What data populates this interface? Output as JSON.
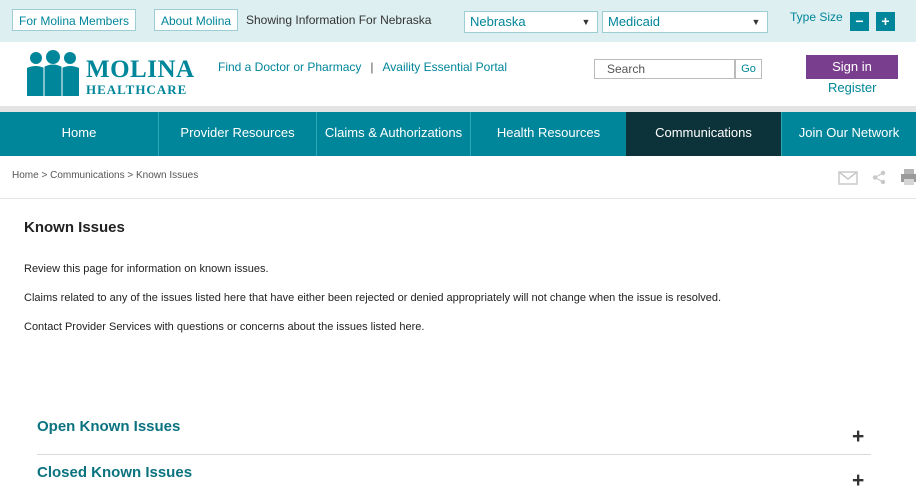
{
  "topbar": {
    "members_tab": "For Molina Members",
    "about_tab": "About Molina",
    "showing_text": "Showing Information For Nebraska",
    "state_select": "Nebraska",
    "plan_select": "Medicaid",
    "type_size_label": "Type Size",
    "decrease": "−",
    "increase": "+"
  },
  "header": {
    "logo_word": "MOLINA",
    "logo_sub": "HEALTHCARE",
    "link_find": "Find a Doctor or Pharmacy",
    "link_sep": "|",
    "link_availity": "Availity Essential Portal",
    "search_placeholder": "Search",
    "go": "Go",
    "sign_in": "Sign in",
    "register": "Register"
  },
  "nav": {
    "items": [
      {
        "label": "Home"
      },
      {
        "label": "Provider Resources"
      },
      {
        "label": "Claims & Authorizations"
      },
      {
        "label": "Health Resources"
      },
      {
        "label": "Communications"
      },
      {
        "label": "Join Our Network"
      }
    ]
  },
  "breadcrumb": {
    "home": "Home",
    "sep": " > ",
    "communications": "Communications",
    "current": "Known Issues"
  },
  "content": {
    "title": "Known Issues",
    "p1": "Review this page for information on known issues.",
    "p2": "Claims related to any of the issues listed here that have either been rejected or denied appropriately will not change when the issue is resolved.",
    "p3": "Contact Provider Services with questions or concerns about the issues listed here."
  },
  "accordion": [
    {
      "title": "Open Known Issues",
      "toggle": "+"
    },
    {
      "title": "Closed Known Issues",
      "toggle": "+"
    }
  ],
  "colors": {
    "teal": "#00869a",
    "nav_active": "#0c3339",
    "sign_in_purple": "#7a3e8e"
  },
  "icons": [
    "email-icon",
    "share-icon",
    "print-icon",
    "chevron-down-icon",
    "molina-logo-icon"
  ]
}
